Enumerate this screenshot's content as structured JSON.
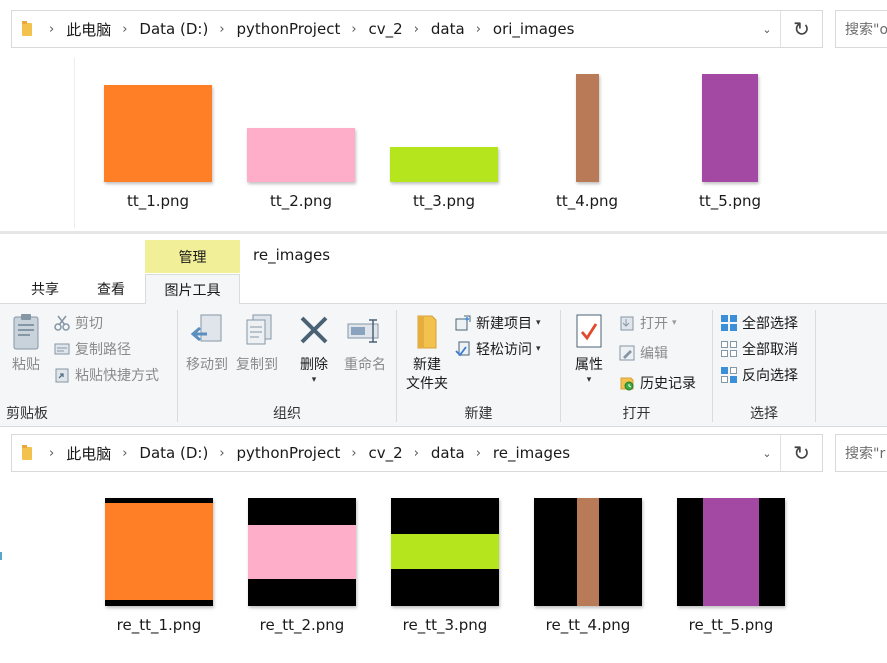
{
  "top_window": {
    "breadcrumb": [
      "此电脑",
      "Data (D:)",
      "pythonProject",
      "cv_2",
      "data",
      "ori_images"
    ],
    "search_placeholder": "搜索\"o",
    "files": [
      {
        "name": "tt_1.png",
        "color": "#FF7F27"
      },
      {
        "name": "tt_2.png",
        "color": "#FFAEC9"
      },
      {
        "name": "tt_3.png",
        "color": "#B5E61D"
      },
      {
        "name": "tt_4.png",
        "color": "#B97A57"
      },
      {
        "name": "tt_5.png",
        "color": "#A349A4"
      }
    ]
  },
  "bottom_window": {
    "title": "re_images",
    "contextual_tab_header": "管理",
    "tabs": {
      "share": "共享",
      "view": "查看",
      "picture_tools": "图片工具"
    },
    "ribbon": {
      "clipboard": {
        "group_label": "剪贴板",
        "paste": "粘贴",
        "cut": "剪切",
        "copy_path": "复制路径",
        "paste_shortcut": "粘贴快捷方式"
      },
      "organize": {
        "group_label": "组织",
        "move_to": "移动到",
        "copy_to": "复制到",
        "delete": "删除",
        "rename": "重命名"
      },
      "new": {
        "group_label": "新建",
        "new_item": "新建项目",
        "easy_access": "轻松访问",
        "new_folder_line1": "新建",
        "new_folder_line2": "文件夹"
      },
      "open": {
        "group_label": "打开",
        "properties": "属性",
        "open": "打开",
        "edit": "编辑",
        "history": "历史记录"
      },
      "select": {
        "group_label": "选择",
        "select_all": "全部选择",
        "select_none": "全部取消",
        "invert_selection": "反向选择"
      }
    },
    "breadcrumb": [
      "此电脑",
      "Data (D:)",
      "pythonProject",
      "cv_2",
      "data",
      "re_images"
    ],
    "search_placeholder": "搜索\"r",
    "files": [
      {
        "name": "re_tt_1.png",
        "color": "#FF7F27"
      },
      {
        "name": "re_tt_2.png",
        "color": "#FFAEC9"
      },
      {
        "name": "re_tt_3.png",
        "color": "#B5E61D"
      },
      {
        "name": "re_tt_4.png",
        "color": "#B97A57"
      },
      {
        "name": "re_tt_5.png",
        "color": "#A349A4"
      }
    ]
  },
  "colors": {
    "contextual_tab": "#F2EF99",
    "ribbon_background": "#F5F6F7",
    "padding_fill": "#000000"
  }
}
